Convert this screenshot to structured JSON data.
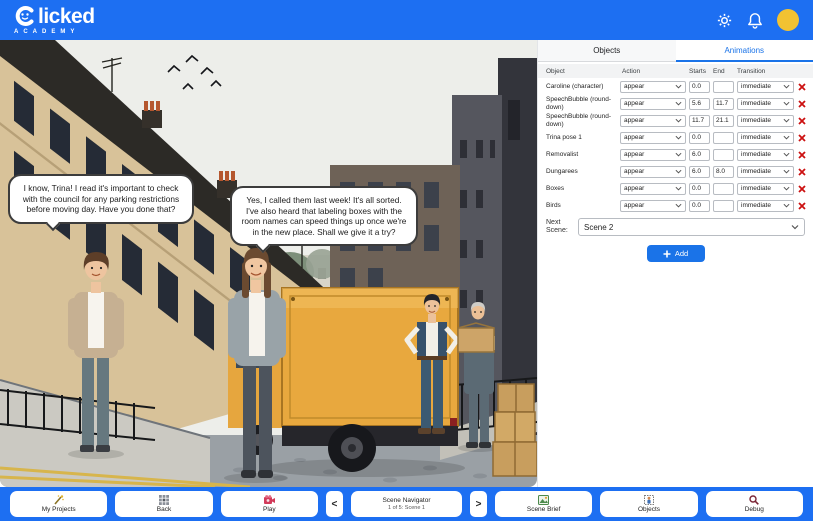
{
  "header": {
    "logo_title": "licked",
    "logo_subtitle": "ACADEMY"
  },
  "scene": {
    "bubble1": "I know, Trina! I read it's important to check with the council for any parking restrictions before moving day. Have you done that?",
    "bubble2": "Yes, I called them last week! It's all sorted. I've also heard that labeling boxes with the room names can speed things up once we're in the new place. Shall we give it a try?"
  },
  "panel": {
    "tabs": [
      {
        "label": "Objects"
      },
      {
        "label": "Animations"
      }
    ],
    "table": {
      "headers": [
        "Object",
        "Action",
        "Starts",
        "End",
        "Transition"
      ],
      "rows": [
        {
          "object": "Caroline (character)",
          "action": "appear",
          "starts": "0.0",
          "end": "",
          "transition": "immediate"
        },
        {
          "object": "SpeechBubble (round-down)",
          "action": "appear",
          "starts": "5.6",
          "end": "11.7",
          "transition": "immediate"
        },
        {
          "object": "SpeechBubble (round-down)",
          "action": "appear",
          "starts": "11.7",
          "end": "21.1",
          "transition": "immediate"
        },
        {
          "object": "Trina pose 1",
          "action": "appear",
          "starts": "0.0",
          "end": "",
          "transition": "immediate"
        },
        {
          "object": "Removalist",
          "action": "appear",
          "starts": "6.0",
          "end": "",
          "transition": "immediate"
        },
        {
          "object": "Dungarees",
          "action": "appear",
          "starts": "6.0",
          "end": "8.0",
          "transition": "immediate"
        },
        {
          "object": "Boxes",
          "action": "appear",
          "starts": "0.0",
          "end": "",
          "transition": "immediate"
        },
        {
          "object": "Birds",
          "action": "appear",
          "starts": "0.0",
          "end": "",
          "transition": "immediate"
        }
      ]
    },
    "next_scene": {
      "label": "Next Scene:",
      "value": "Scene 2"
    },
    "add_label": "Add"
  },
  "toolbar": {
    "my_projects": "My Projects",
    "back": "Back",
    "play": "Play",
    "prev": "<",
    "next": ">",
    "nav_title": "Scene Navigator",
    "nav_subtitle": "1 of 5: Scene 1",
    "scene_brief": "Scene Brief",
    "objects": "Objects",
    "debug": "Debug"
  },
  "colors": {
    "accent": "#1d6ff2",
    "tab_active": "#1a73e8",
    "add_button": "#1a73e8",
    "delete": "#cc1414",
    "avatar": "#f2c232",
    "truck": "#e8a83e"
  }
}
